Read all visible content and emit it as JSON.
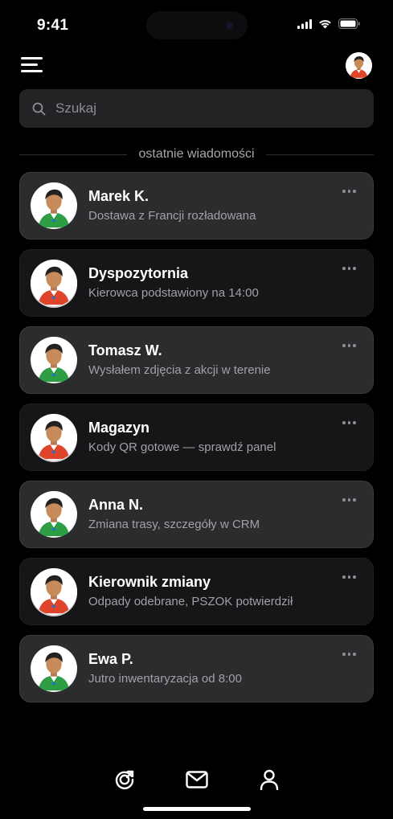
{
  "status_bar": {
    "time": "9:41"
  },
  "header": {
    "menu_icon": "hamburger-menu-icon",
    "profile_icon": "user-avatar"
  },
  "search": {
    "placeholder": "Szukaj",
    "value": ""
  },
  "section": {
    "title": "ostatnie wiadomości"
  },
  "chats": [
    {
      "name": "Marek K.",
      "preview": "Dostawa z Francji rozładowana",
      "avatar": "green"
    },
    {
      "name": "Dyspozytornia",
      "preview": "Kierowca podstawiony na 14:00",
      "avatar": "red"
    },
    {
      "name": "Tomasz W.",
      "preview": "Wysłałem zdjęcia z akcji w terenie",
      "avatar": "green"
    },
    {
      "name": "Magazyn",
      "preview": "Kody QR gotowe — sprawdź panel",
      "avatar": "red"
    },
    {
      "name": "Anna N.",
      "preview": "Zmiana trasy, szczegóły w CRM",
      "avatar": "green"
    },
    {
      "name": "Kierownik zmiany",
      "preview": "Odpady odebrane, PSZOK potwierdził",
      "avatar": "red"
    },
    {
      "name": "Ewa P.",
      "preview": "Jutro inwentaryzacja od 8:00",
      "avatar": "green"
    }
  ],
  "tab_bar": {
    "tabs": [
      "recycle-icon",
      "mail-icon",
      "profile-icon"
    ]
  },
  "colors": {
    "background": "#000000",
    "card_light": "#2c2c2e",
    "card_dark": "#161618",
    "avatar_green": "#2e9e44",
    "avatar_red": "#e0452b"
  }
}
